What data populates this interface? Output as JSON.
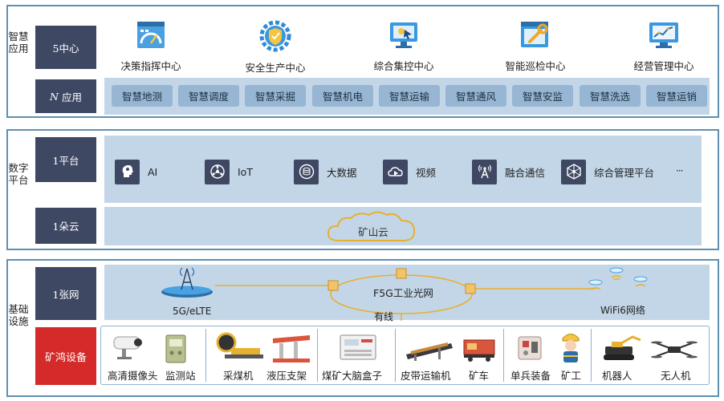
{
  "layers": {
    "application": {
      "title": "智慧应用",
      "row1_label": "5中心",
      "row2_label_prefix": "N",
      "row2_label_suffix": " 应用",
      "centers": [
        {
          "label": "决策指挥中心",
          "icon": "dashboard-icon"
        },
        {
          "label": "安全生产中心",
          "icon": "shield-gear-icon"
        },
        {
          "label": "综合集控中心",
          "icon": "monitor-cursor-icon"
        },
        {
          "label": "智能巡检中心",
          "icon": "wrench-window-icon"
        },
        {
          "label": "经营管理中心",
          "icon": "line-chart-monitor-icon"
        }
      ],
      "apps": [
        "智慧地测",
        "智慧调度",
        "智慧采掘",
        "智慧机电",
        "智慧运输",
        "智慧通风",
        "智慧安监",
        "智慧洗选",
        "智慧运销"
      ]
    },
    "platform": {
      "title": "数字平台",
      "row1_label": "1平台",
      "row2_label": "1朵云",
      "items": [
        {
          "label": "AI",
          "icon": "ai-head-icon"
        },
        {
          "label": "IoT",
          "icon": "iot-network-icon"
        },
        {
          "label": "大数据",
          "icon": "big-data-icon"
        },
        {
          "label": "视频",
          "icon": "video-cloud-icon"
        },
        {
          "label": "融合通信",
          "icon": "signal-tower-icon"
        },
        {
          "label": "综合管理平台",
          "icon": "hub-network-icon"
        }
      ],
      "more": "···",
      "cloud_label": "矿山云"
    },
    "infrastructure": {
      "title": "基础设施",
      "row1_label": "1张网",
      "row2_label": "矿鸿设备",
      "network": {
        "base_station": "5G/eLTE",
        "ring": "F5G工业光网",
        "wired": "有线",
        "wifi": "WiFi6网络"
      },
      "devices": [
        "高清摄像头",
        "监测站",
        "采煤机",
        "液压支架",
        "煤矿大脑盒子",
        "皮带运输机",
        "矿车",
        "单兵装备",
        "矿工",
        "机器人",
        "无人机"
      ]
    }
  },
  "colors": {
    "border": "#5f8fb0",
    "panel": "#c3d6e7",
    "button": "#96b6d3",
    "dark": "#3f4863",
    "red": "#d42a2a",
    "ring": "#e6b030"
  }
}
